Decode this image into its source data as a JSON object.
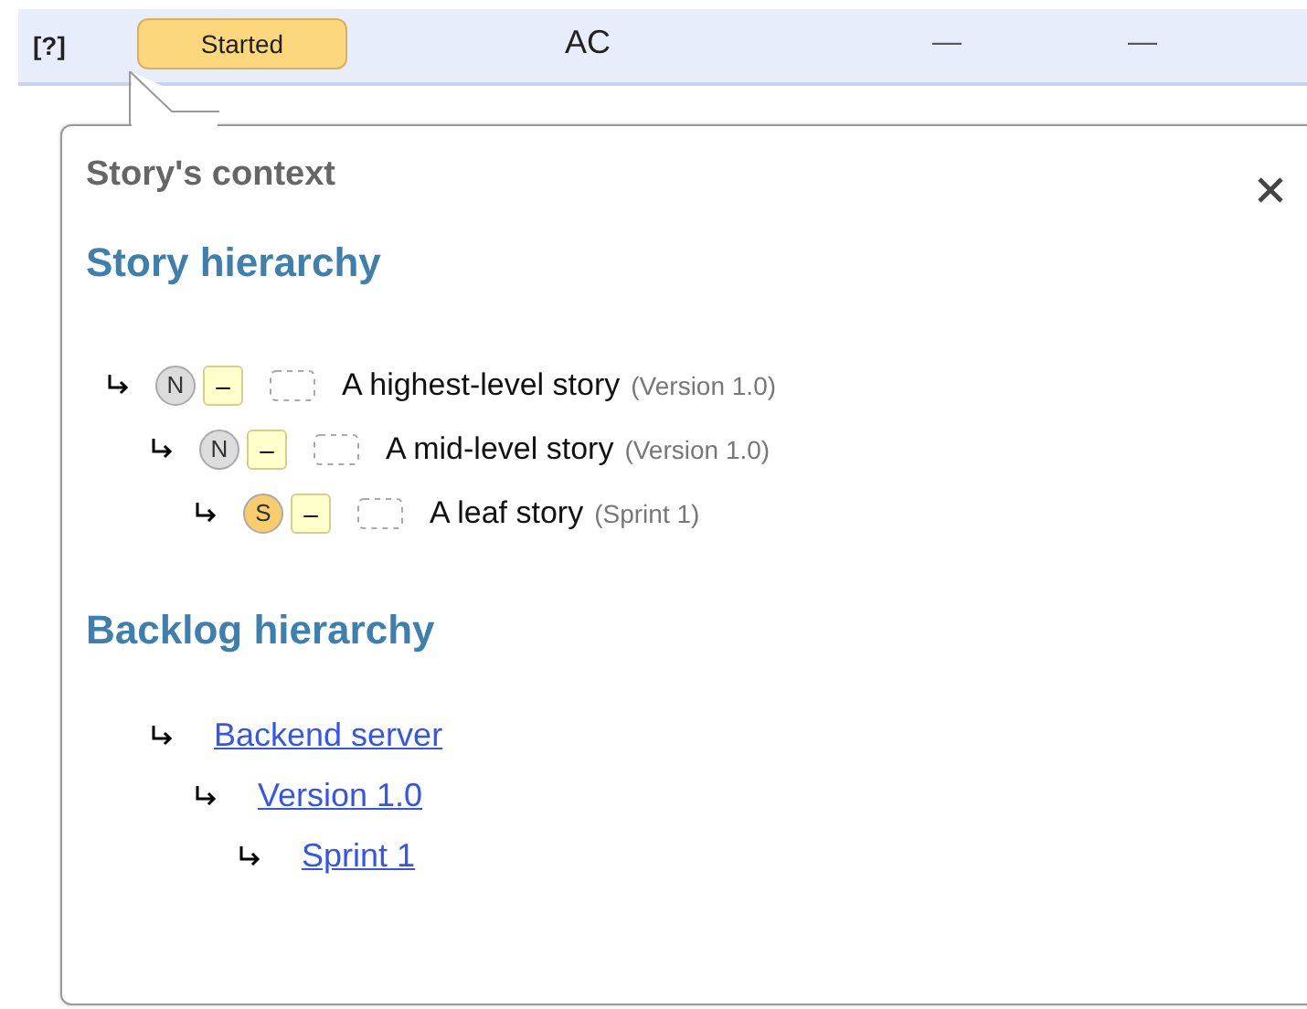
{
  "row": {
    "help": "[?]",
    "status": "Started",
    "owner": "AC",
    "column_4": "—",
    "column_5": "—"
  },
  "popup": {
    "title": "Story's context",
    "story_hierarchy": {
      "heading": "Story hierarchy",
      "stories": [
        {
          "state": "N",
          "color": "#dcdcdc",
          "points": "–",
          "name": "A highest-level story",
          "backlog": "(Version 1.0)",
          "children": [
            {
              "state": "N",
              "color": "#dcdcdc",
              "points": "–",
              "name": "A mid-level story",
              "backlog": "(Version 1.0)",
              "children": [
                {
                  "state": "S",
                  "color": "#f7cd6e",
                  "points": "–",
                  "name": "A leaf story",
                  "backlog": "(Sprint 1)"
                }
              ]
            }
          ]
        }
      ]
    },
    "backlog_hierarchy": {
      "heading": "Backlog hierarchy",
      "items": [
        {
          "name": "Backend server",
          "children": [
            {
              "name": "Version 1.0",
              "children": [
                {
                  "name": "Sprint 1"
                }
              ]
            }
          ]
        }
      ]
    }
  }
}
